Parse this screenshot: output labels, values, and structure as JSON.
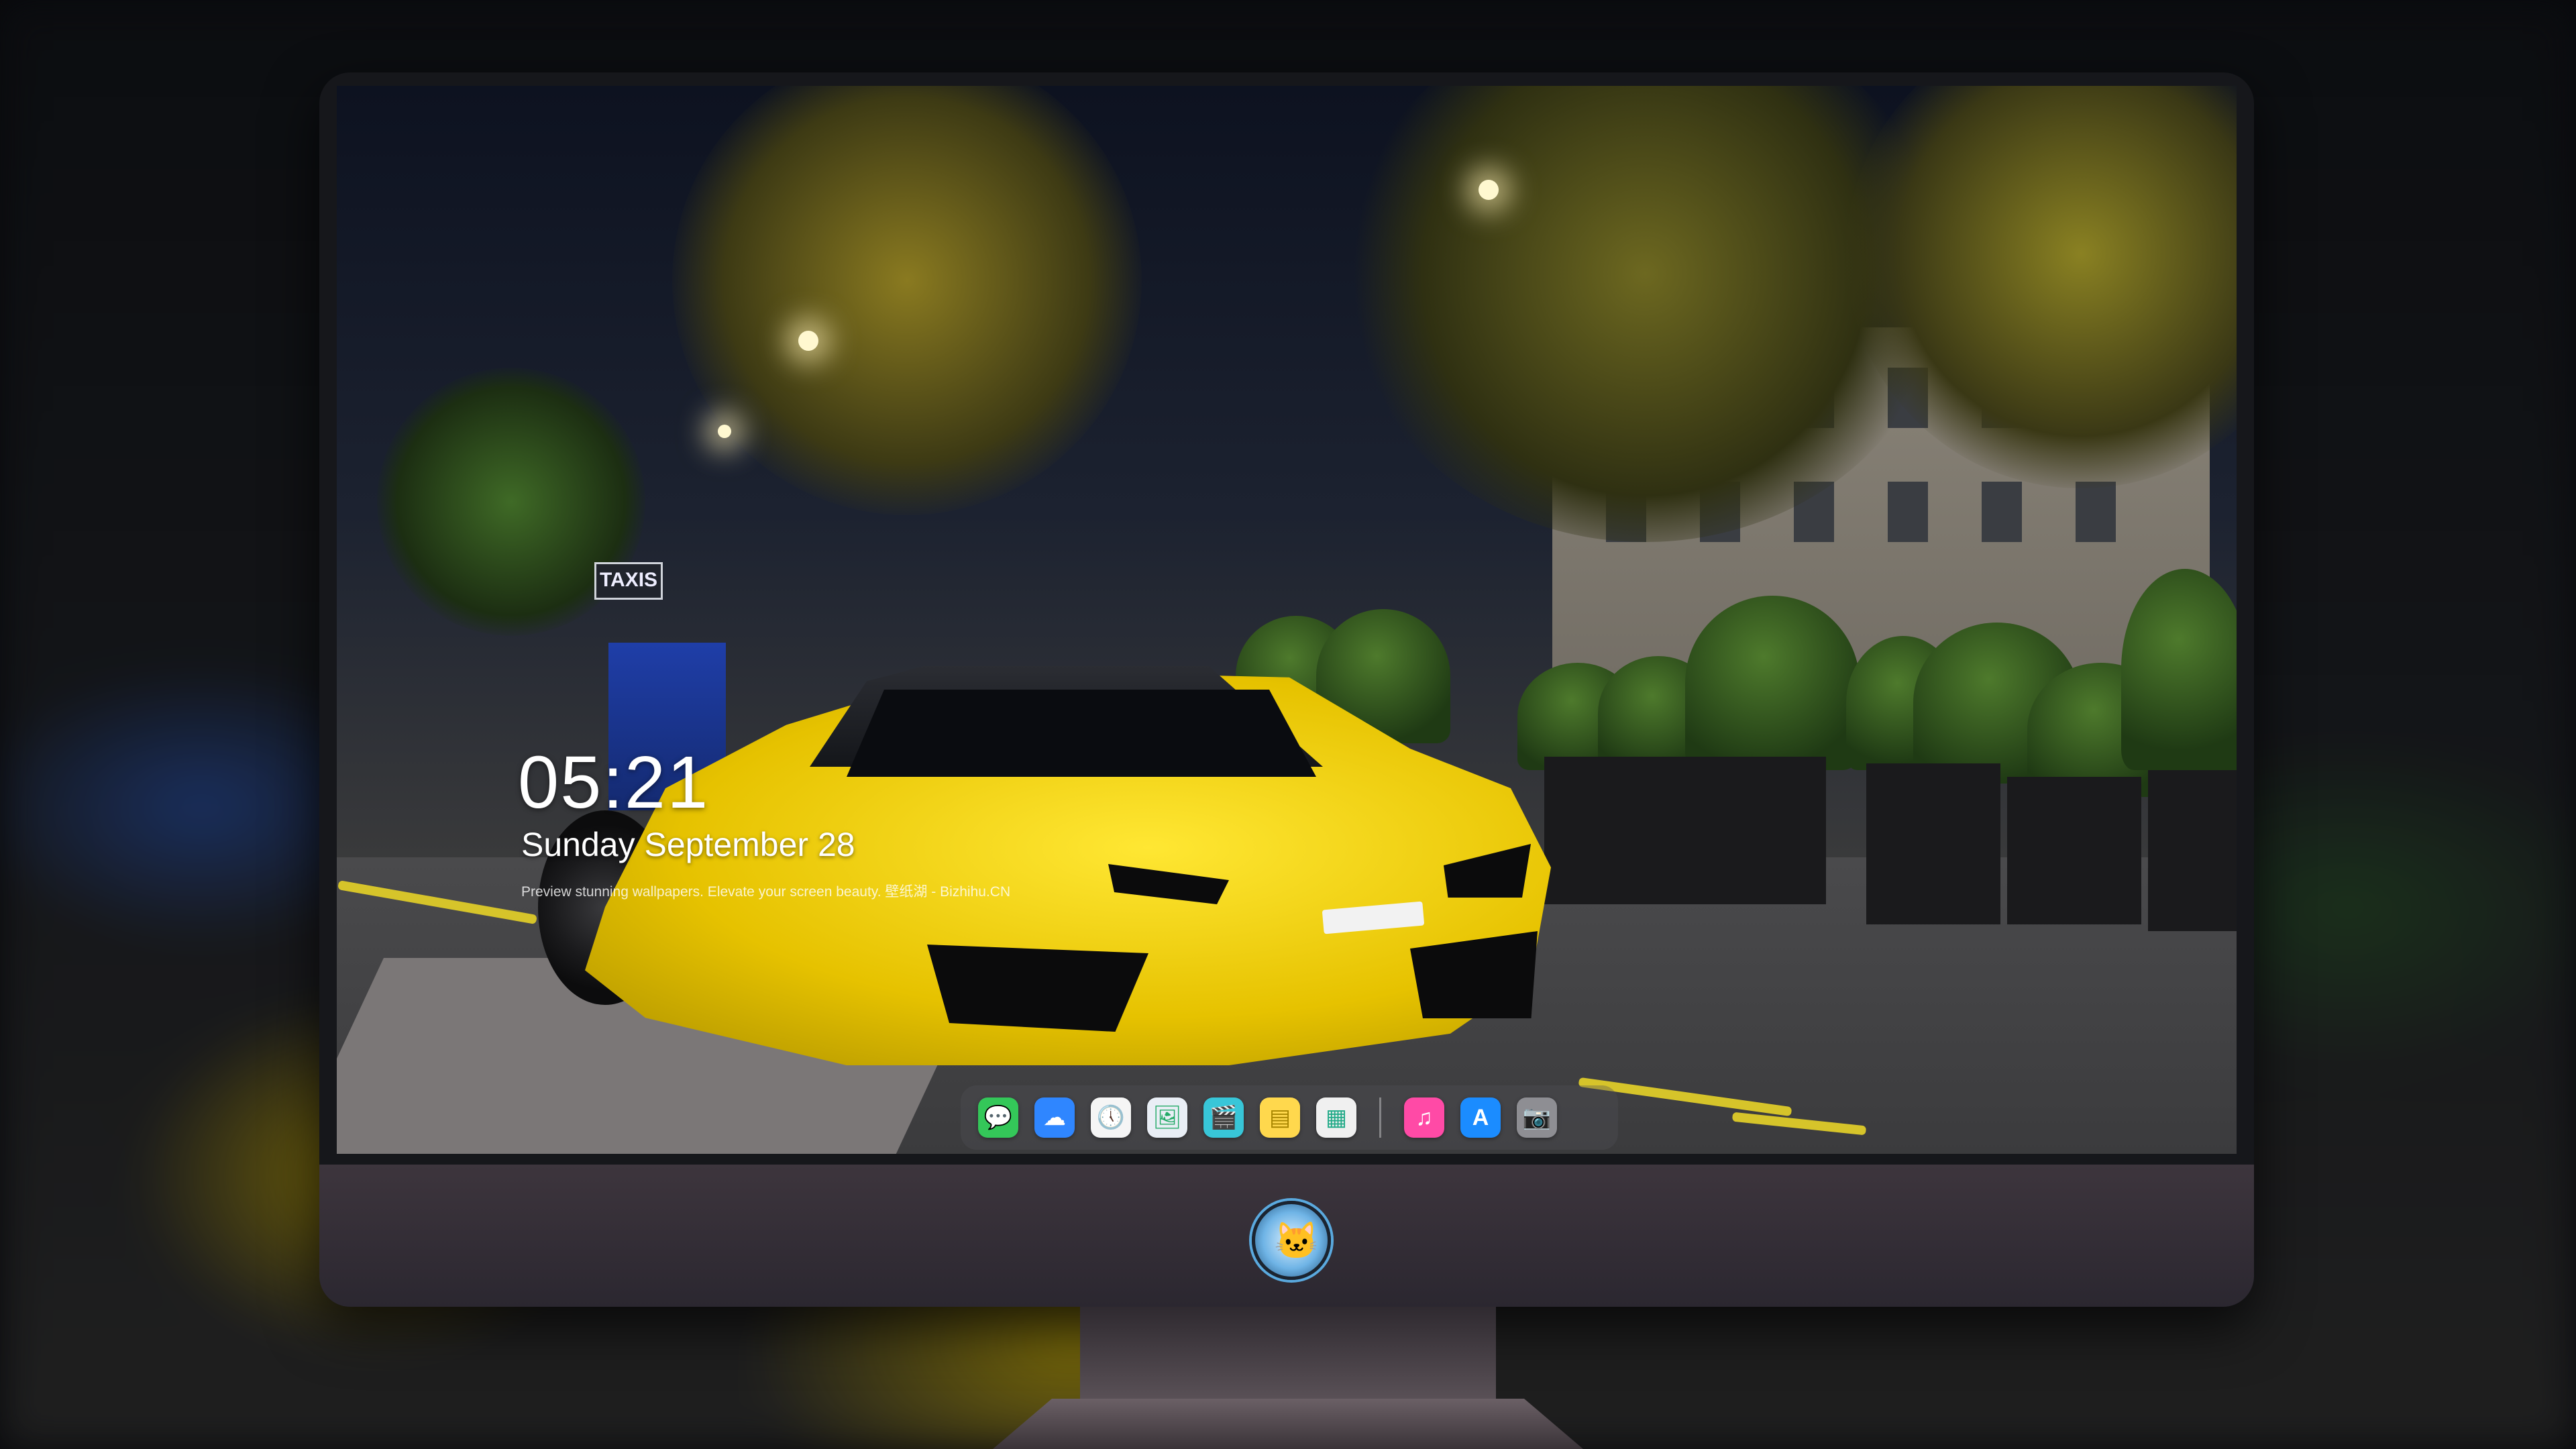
{
  "lockscreen": {
    "time": "05:21",
    "date": "Sunday September 28",
    "tagline": "Preview stunning wallpapers. Elevate your screen beauty. 壁纸湖 - Bizhihu.CN"
  },
  "wallpaper": {
    "taxi_sign": "TAXIS"
  },
  "dock": {
    "apps": [
      {
        "name": "Messages",
        "icon": "messages-icon",
        "color": "#34c759",
        "glyph": "💬"
      },
      {
        "name": "Weather",
        "icon": "weather-icon",
        "color": "#2f86ff",
        "glyph": "☁"
      },
      {
        "name": "Clock",
        "icon": "clock-icon",
        "color": "#f5f5f5",
        "glyph": "🕔"
      },
      {
        "name": "Preview",
        "icon": "preview-icon",
        "color": "#e9eef5",
        "glyph": "🖼"
      },
      {
        "name": "Final Cut",
        "icon": "clapperboard-icon",
        "color": "#38c6d8",
        "glyph": "🎬"
      },
      {
        "name": "Notes",
        "icon": "notes-icon",
        "color": "#ffd84d",
        "glyph": "▤"
      },
      {
        "name": "Photos Booth",
        "icon": "photo-gallery-icon",
        "color": "#f0f0f0",
        "glyph": "▦"
      },
      {
        "name": "Music",
        "icon": "music-icon",
        "color": "#ff4aa6",
        "glyph": "♫"
      },
      {
        "name": "App Store",
        "icon": "app-store-icon",
        "color": "#1b8cff",
        "glyph": "A"
      },
      {
        "name": "Camera",
        "icon": "camera-icon",
        "color": "#8e8e93",
        "glyph": "📷"
      }
    ]
  },
  "colors": {
    "car": "#f4d600",
    "monitor_chin": "#3a323a"
  }
}
